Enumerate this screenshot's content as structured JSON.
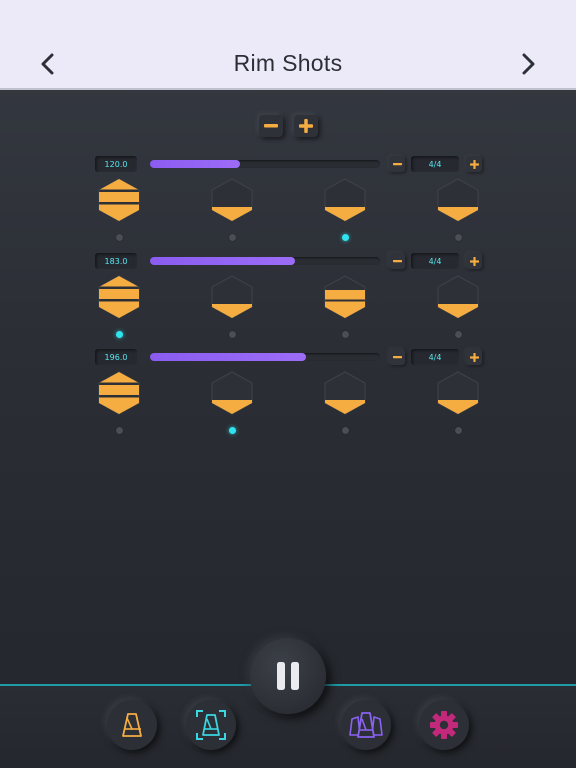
{
  "header": {
    "title": "Rim Shots"
  },
  "colors": {
    "accent": "#f5ad42",
    "slider": "#9362f3",
    "active_dot": "#2fe4ee",
    "header_bg": "#eceaf8"
  },
  "icons": {
    "prev": "chevron-left-icon",
    "next": "chevron-right-icon",
    "minus": "minus-icon",
    "plus": "plus-icon",
    "pause": "pause-icon",
    "metronome": "metronome-icon",
    "focus_metronome": "focus-metronome-icon",
    "multi_metronome": "multi-metronome-icon",
    "settings": "gear-icon"
  },
  "tracks": [
    {
      "tempo": "120.0",
      "tempo_fraction": 0.39,
      "signature": "4/4",
      "beats": [
        "full",
        "low",
        "low",
        "low"
      ],
      "active_beat": 2
    },
    {
      "tempo": "183.0",
      "tempo_fraction": 0.63,
      "signature": "4/4",
      "beats": [
        "full",
        "low",
        "mid",
        "low"
      ],
      "active_beat": 0
    },
    {
      "tempo": "196.0",
      "tempo_fraction": 0.68,
      "signature": "4/4",
      "beats": [
        "full",
        "low",
        "low",
        "low"
      ],
      "active_beat": 1
    }
  ]
}
